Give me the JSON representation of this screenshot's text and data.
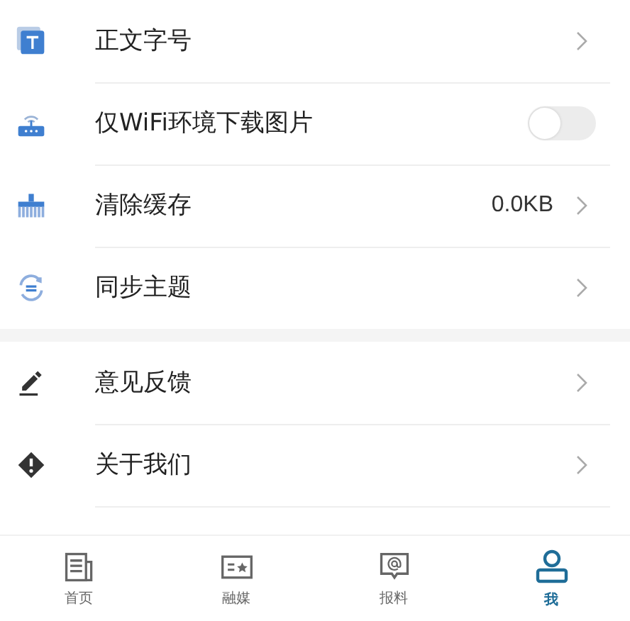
{
  "settings_groups": [
    {
      "items": [
        {
          "kind": "link",
          "label": "正文字号"
        },
        {
          "kind": "toggle",
          "label": "仅WiFi环境下载图片",
          "on": false
        },
        {
          "kind": "value",
          "label": "清除缓存",
          "value": "0.0KB"
        },
        {
          "kind": "link",
          "label": "同步主题"
        }
      ]
    },
    {
      "items": [
        {
          "kind": "link",
          "label": "意见反馈"
        },
        {
          "kind": "link",
          "label": "关于我们"
        }
      ]
    }
  ],
  "tab_bar": [
    {
      "label": "首页",
      "selected": false
    },
    {
      "label": "融媒",
      "selected": false
    },
    {
      "label": "报料",
      "selected": false
    },
    {
      "label": "我",
      "selected": true
    }
  ]
}
